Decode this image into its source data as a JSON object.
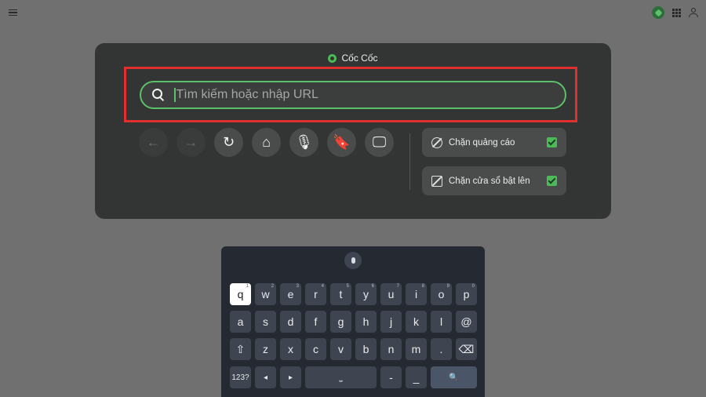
{
  "browser": {
    "brand": "Cốc Cốc"
  },
  "search": {
    "placeholder": "Tìm kiếm hoặc nhập URL",
    "value": ""
  },
  "nav": {
    "buttons": [
      {
        "name": "back-button",
        "icon": "arrow-left-icon",
        "glyph": "←",
        "enabled": false
      },
      {
        "name": "forward-button",
        "icon": "arrow-right-icon",
        "glyph": "→",
        "enabled": false
      },
      {
        "name": "reload-button",
        "icon": "reload-icon",
        "glyph": "↻",
        "enabled": true
      },
      {
        "name": "home-button",
        "icon": "home-icon",
        "glyph": "⌂",
        "enabled": true
      },
      {
        "name": "voice-search-button",
        "icon": "microphone-icon",
        "glyph": "🎙",
        "enabled": true
      },
      {
        "name": "bookmark-button",
        "icon": "bookmark-icon",
        "glyph": "🔖",
        "enabled": true
      },
      {
        "name": "desktop-mode-button",
        "icon": "monitor-icon",
        "glyph": "🖵",
        "enabled": true
      }
    ]
  },
  "toggles": {
    "adblock": {
      "label": "Chặn quảng cáo",
      "checked": true
    },
    "popup": {
      "label": "Chặn cửa sổ bật lên",
      "checked": true
    }
  },
  "keyboard": {
    "row1": [
      [
        "q",
        "1"
      ],
      [
        "w",
        "2"
      ],
      [
        "e",
        "3"
      ],
      [
        "r",
        "4"
      ],
      [
        "t",
        "5"
      ],
      [
        "y",
        "6"
      ],
      [
        "u",
        "7"
      ],
      [
        "i",
        "8"
      ],
      [
        "o",
        "9"
      ],
      [
        "p",
        "0"
      ]
    ],
    "row2": [
      "a",
      "s",
      "d",
      "f",
      "g",
      "h",
      "j",
      "k",
      "l",
      "@"
    ],
    "row3": [
      "z",
      "x",
      "c",
      "v",
      "b",
      "n",
      "m",
      "."
    ],
    "bottom": {
      "numbers": "123?",
      "left": "◂",
      "right": "▸",
      "space": "⎵",
      "dash": "-",
      "underscore": "_"
    },
    "shift_glyph": "⇧",
    "backspace_glyph": "⌫",
    "search_glyph": "🔍"
  },
  "colors": {
    "accent": "#5cc26a",
    "highlight": "#e03030",
    "panel": "#333434"
  }
}
